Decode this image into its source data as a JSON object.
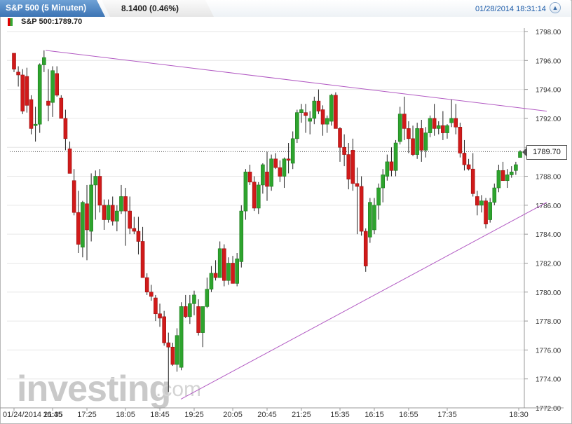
{
  "header": {
    "title": "S&P 500 (5 Minuten)",
    "change": "8.1400 (0.46%)",
    "timestamp": "01/28/2014 18:31:14",
    "maximize_icon": "maximize-icon"
  },
  "legend": {
    "label": "S&P 500:1789.70"
  },
  "watermark": {
    "brand": "investing",
    "suffix": ".com"
  },
  "colors": {
    "up": "#2ea42e",
    "down": "#d11a1a",
    "trendline": "#b25ac3",
    "title_bg": "#4a82c0"
  },
  "chart_data": {
    "type": "candlestick",
    "current_price": "1789.70",
    "ylim": [
      1772,
      1798
    ],
    "yticks": [
      "1772.00",
      "1774.00",
      "1776.00",
      "1778.00",
      "1780.00",
      "1782.00",
      "1784.00",
      "1786.00",
      "1788.00",
      "1790.00",
      "1792.00",
      "1794.00",
      "1796.00",
      "1798.00"
    ],
    "xticks": [
      "01/24/2014 21:35",
      "16:45",
      "17:25",
      "18:05",
      "18:45",
      "19:25",
      "20:05",
      "20:45",
      "21:25",
      "15:35",
      "16:15",
      "16:55",
      "17:35",
      "18:30"
    ],
    "candles": [
      [
        1796.5,
        1796.5,
        1795.2,
        1795.4
      ],
      [
        1795.2,
        1795.6,
        1794.2,
        1795.0
      ],
      [
        1795.0,
        1795.4,
        1792.3,
        1792.5
      ],
      [
        1794.9,
        1795.5,
        1792.4,
        1792.9
      ],
      [
        1793.3,
        1793.6,
        1790.9,
        1791.3
      ],
      [
        1791.5,
        1792.8,
        1790.4,
        1791.6
      ],
      [
        1791.6,
        1795.8,
        1791.0,
        1795.7
      ],
      [
        1795.7,
        1796.7,
        1795.2,
        1796.2
      ],
      [
        1793.2,
        1795.4,
        1791.8,
        1792.9
      ],
      [
        1793.1,
        1795.6,
        1792.1,
        1795.3
      ],
      [
        1795.1,
        1795.6,
        1793.5,
        1793.6
      ],
      [
        1793.4,
        1793.6,
        1792.0,
        1792.0
      ],
      [
        1792.0,
        1792.6,
        1789.8,
        1790.6
      ],
      [
        1789.9,
        1790.4,
        1788.2,
        1788.2
      ],
      [
        1787.7,
        1788.5,
        1785.3,
        1785.5
      ],
      [
        1785.5,
        1787.0,
        1782.7,
        1783.3
      ],
      [
        1783.1,
        1786.3,
        1782.4,
        1786.2
      ],
      [
        1786.1,
        1787.4,
        1782.2,
        1784.3
      ],
      [
        1784.2,
        1788.2,
        1783.5,
        1787.4
      ],
      [
        1787.4,
        1788.4,
        1785.0,
        1788.0
      ],
      [
        1788.0,
        1788.5,
        1785.5,
        1786.0
      ],
      [
        1786.0,
        1786.4,
        1784.3,
        1785.0
      ],
      [
        1785.0,
        1786.4,
        1784.8,
        1786.0
      ],
      [
        1786.0,
        1786.6,
        1784.6,
        1784.9
      ],
      [
        1784.9,
        1786.0,
        1784.2,
        1785.6
      ],
      [
        1785.6,
        1787.4,
        1785.4,
        1786.6
      ],
      [
        1786.6,
        1787.2,
        1783.2,
        1785.6
      ],
      [
        1785.6,
        1786.6,
        1784.0,
        1784.4
      ],
      [
        1784.4,
        1785.2,
        1784.0,
        1784.2
      ],
      [
        1784.2,
        1785.2,
        1782.6,
        1783.5
      ],
      [
        1783.5,
        1784.5,
        1781.0,
        1781.0
      ],
      [
        1781.0,
        1781.3,
        1779.8,
        1780.0
      ],
      [
        1780.0,
        1780.5,
        1779.4,
        1779.7
      ],
      [
        1779.6,
        1779.8,
        1778.0,
        1778.5
      ],
      [
        1778.5,
        1779.2,
        1777.6,
        1778.2
      ],
      [
        1778.3,
        1778.7,
        1776.3,
        1776.5
      ],
      [
        1776.5,
        1777.2,
        1773.1,
        1776.2
      ],
      [
        1776.2,
        1776.5,
        1774.9,
        1775.0
      ],
      [
        1775.0,
        1777.5,
        1774.5,
        1777.0
      ],
      [
        1774.8,
        1779.3,
        1774.6,
        1779.0
      ],
      [
        1779.0,
        1779.8,
        1778.2,
        1778.3
      ],
      [
        1778.3,
        1779.8,
        1777.8,
        1779.2
      ],
      [
        1779.2,
        1780.1,
        1778.4,
        1779.8
      ],
      [
        1779.0,
        1779.5,
        1777.0,
        1777.2
      ],
      [
        1777.2,
        1779.0,
        1776.2,
        1779.0
      ],
      [
        1779.0,
        1781.0,
        1778.9,
        1780.2
      ],
      [
        1780.2,
        1781.8,
        1780.0,
        1781.3
      ],
      [
        1781.3,
        1782.2,
        1780.8,
        1781.0
      ],
      [
        1781.0,
        1783.5,
        1781.0,
        1783.0
      ],
      [
        1783.0,
        1783.3,
        1780.4,
        1780.8
      ],
      [
        1780.8,
        1782.4,
        1780.5,
        1782.0
      ],
      [
        1782.0,
        1782.5,
        1780.6,
        1780.6
      ],
      [
        1780.6,
        1782.7,
        1780.4,
        1782.3
      ],
      [
        1782.1,
        1786.0,
        1781.7,
        1785.6
      ],
      [
        1785.6,
        1788.5,
        1785.0,
        1788.3
      ],
      [
        1788.3,
        1788.8,
        1787.4,
        1787.6
      ],
      [
        1787.6,
        1788.0,
        1785.6,
        1785.8
      ],
      [
        1785.8,
        1787.6,
        1785.4,
        1787.4
      ],
      [
        1787.4,
        1788.9,
        1786.8,
        1788.8
      ],
      [
        1788.3,
        1789.7,
        1786.3,
        1787.3
      ],
      [
        1787.3,
        1789.5,
        1787.0,
        1789.2
      ],
      [
        1789.2,
        1789.6,
        1788.5,
        1788.6
      ],
      [
        1788.6,
        1789.1,
        1787.6,
        1788.0
      ],
      [
        1788.0,
        1789.3,
        1787.2,
        1789.2
      ],
      [
        1789.2,
        1790.3,
        1788.2,
        1789.1
      ],
      [
        1788.9,
        1791.1,
        1788.5,
        1790.6
      ],
      [
        1790.6,
        1792.6,
        1790.3,
        1792.4
      ],
      [
        1792.4,
        1793.0,
        1791.7,
        1792.6
      ],
      [
        1792.4,
        1793.0,
        1791.0,
        1792.2
      ],
      [
        1791.8,
        1792.5,
        1790.9,
        1792.0
      ],
      [
        1792.0,
        1793.5,
        1791.6,
        1793.2
      ],
      [
        1793.2,
        1794.0,
        1792.3,
        1792.5
      ],
      [
        1792.6,
        1792.9,
        1790.8,
        1791.6
      ],
      [
        1791.6,
        1792.2,
        1791.0,
        1792.0
      ],
      [
        1791.8,
        1793.7,
        1791.5,
        1793.6
      ],
      [
        1793.6,
        1793.8,
        1791.3,
        1791.3
      ],
      [
        1791.3,
        1791.4,
        1789.0,
        1790.0
      ],
      [
        1790.0,
        1790.9,
        1788.7,
        1789.5
      ],
      [
        1789.5,
        1790.3,
        1787.1,
        1787.8
      ],
      [
        1789.8,
        1790.6,
        1787.0,
        1787.5
      ],
      [
        1787.5,
        1788.6,
        1784.0,
        1787.3
      ],
      [
        1787.3,
        1788.0,
        1783.9,
        1784.2
      ],
      [
        1784.2,
        1784.4,
        1781.4,
        1781.8
      ],
      [
        1783.8,
        1786.5,
        1783.4,
        1786.2
      ],
      [
        1784.3,
        1786.5,
        1784.0,
        1786.0
      ],
      [
        1786.0,
        1787.5,
        1785.0,
        1787.2
      ],
      [
        1787.2,
        1788.5,
        1786.2,
        1788.1
      ],
      [
        1788.0,
        1789.5,
        1787.7,
        1789.0
      ],
      [
        1789.0,
        1790.0,
        1788.0,
        1788.4
      ],
      [
        1788.4,
        1790.5,
        1788.0,
        1790.3
      ],
      [
        1790.4,
        1792.8,
        1790.2,
        1792.3
      ],
      [
        1792.3,
        1793.5,
        1790.5,
        1791.3
      ],
      [
        1791.3,
        1791.8,
        1789.6,
        1790.6
      ],
      [
        1790.6,
        1791.5,
        1789.4,
        1789.5
      ],
      [
        1789.5,
        1791.7,
        1789.2,
        1791.3
      ],
      [
        1791.3,
        1791.9,
        1789.0,
        1789.8
      ],
      [
        1789.8,
        1791.4,
        1789.3,
        1791.0
      ],
      [
        1791.0,
        1792.2,
        1790.7,
        1792.0
      ],
      [
        1792.0,
        1793.0,
        1790.8,
        1791.3
      ],
      [
        1791.3,
        1791.8,
        1790.9,
        1791.5
      ],
      [
        1791.5,
        1792.5,
        1790.5,
        1791.0
      ],
      [
        1791.0,
        1791.6,
        1790.6,
        1791.5
      ],
      [
        1791.7,
        1793.3,
        1791.4,
        1792.0
      ],
      [
        1792.0,
        1793.0,
        1790.9,
        1791.4
      ],
      [
        1791.4,
        1791.7,
        1789.3,
        1789.6
      ],
      [
        1789.6,
        1790.5,
        1788.4,
        1788.8
      ],
      [
        1788.8,
        1789.2,
        1788.4,
        1788.5
      ],
      [
        1788.5,
        1789.6,
        1786.6,
        1786.8
      ],
      [
        1786.6,
        1787.0,
        1785.3,
        1786.0
      ],
      [
        1786.0,
        1786.7,
        1785.5,
        1786.3
      ],
      [
        1786.3,
        1786.5,
        1784.4,
        1784.7
      ],
      [
        1785.0,
        1786.5,
        1784.8,
        1786.2
      ],
      [
        1786.2,
        1787.5,
        1786.0,
        1787.2
      ],
      [
        1787.2,
        1788.8,
        1786.9,
        1788.4
      ],
      [
        1788.4,
        1789.0,
        1787.7,
        1787.7
      ],
      [
        1787.7,
        1788.5,
        1787.2,
        1788.1
      ],
      [
        1788.1,
        1788.7,
        1787.9,
        1788.3
      ],
      [
        1788.4,
        1789.0,
        1788.1,
        1788.8
      ],
      [
        1789.3,
        1789.8,
        1789.3,
        1789.7
      ]
    ],
    "trendlines": [
      {
        "from": [
          "01/24/2014 21:35",
          1796.7
        ],
        "to": [
          "18:30",
          1792.5
        ]
      },
      {
        "from": [
          "18:05",
          1772.6
        ],
        "to": [
          "18:30",
          1786.2
        ]
      }
    ],
    "grid": true
  }
}
